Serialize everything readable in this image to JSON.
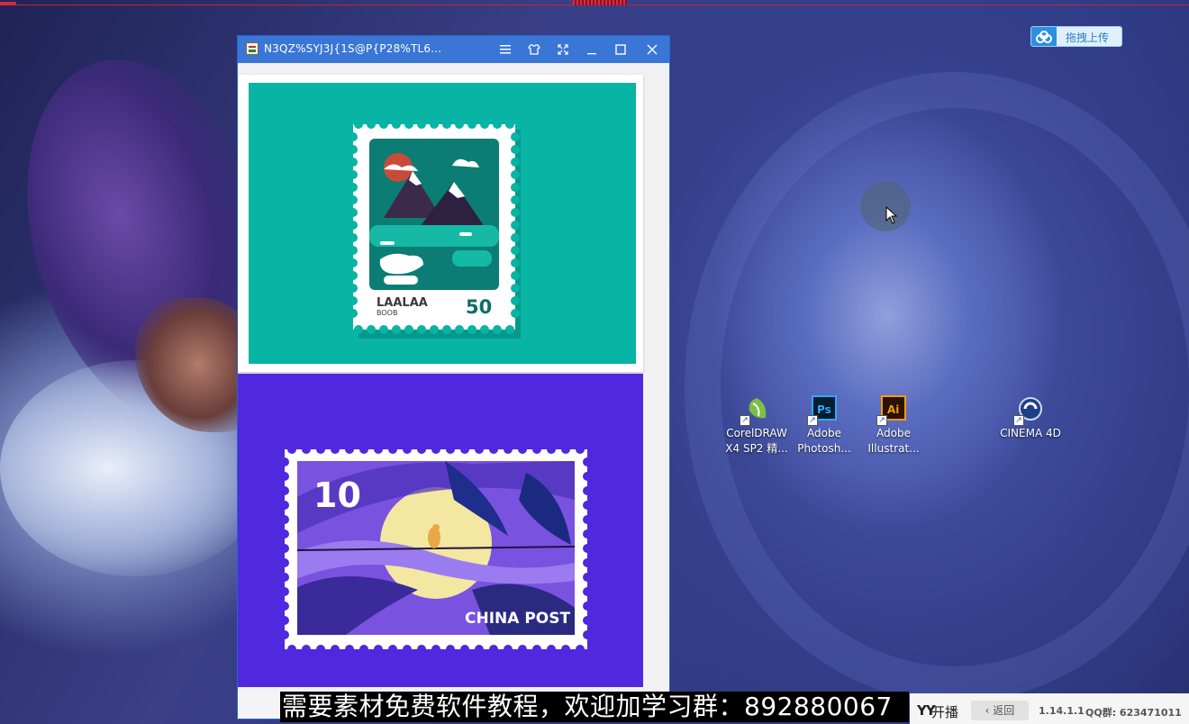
{
  "window": {
    "title": "N3QZ%SYJ3J{1S@P{P28%TL6...",
    "controls": [
      "menu-icon",
      "skin-icon",
      "fullscreen-icon",
      "minimize-icon",
      "maximize-icon",
      "close-icon"
    ]
  },
  "upload_widget": {
    "label": "拖拽上传"
  },
  "stamp1": {
    "brand": "LAALAA",
    "sub": "BOOB",
    "value": "50",
    "colors": {
      "background": "#08b4a4",
      "frame": "#ffffff",
      "inner": "#0b7d74"
    }
  },
  "stamp2": {
    "value": "10",
    "caption": "CHINA POST",
    "colors": {
      "background": "#5028de",
      "scene": "#6b45d6",
      "moon": "#f4e7a2"
    }
  },
  "desktop_icons": [
    {
      "line1": "CorelDRAW",
      "line2": "X4 SP2 精...",
      "icon": "coreldraw-icon"
    },
    {
      "line1": "Adobe",
      "line2": "Photosh...",
      "icon": "photoshop-icon"
    },
    {
      "line1": "Adobe",
      "line2": "Illustrat...",
      "icon": "illustrator-icon"
    },
    {
      "line1": "CINEMA 4D",
      "line2": "",
      "icon": "cinema4d-icon"
    }
  ],
  "subtitle": "需要素材免费软件教程，欢迎加学习群：892880067",
  "bottom_bar": {
    "broadcast_prefix": "YY",
    "broadcast": "开播",
    "back": "返回",
    "version": "1.14.1.1",
    "qq_group": "QQ群: 623471011"
  }
}
